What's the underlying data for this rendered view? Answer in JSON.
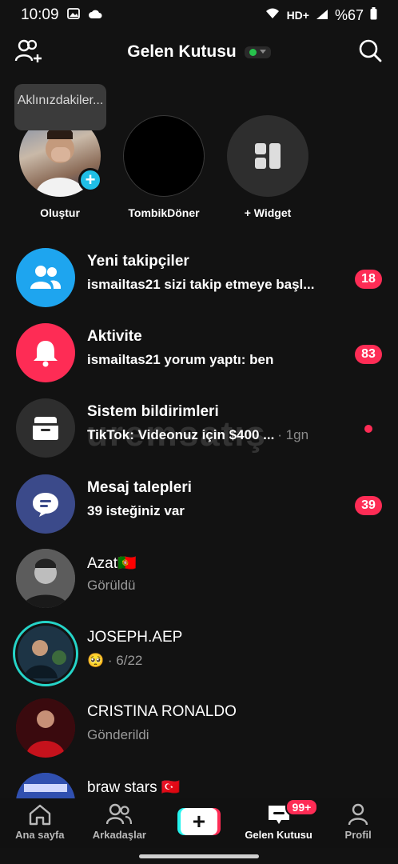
{
  "status_bar": {
    "time": "10:09",
    "battery": "%67",
    "network": "HD+"
  },
  "header": {
    "title": "Gelen Kutusu"
  },
  "tooltip": "Aklınızdakiler...",
  "stories": [
    {
      "label": "Oluştur"
    },
    {
      "label": "TombikDöner"
    },
    {
      "label": "+ Widget"
    }
  ],
  "rows": [
    {
      "title": "Yeni takipçiler",
      "subtitle": "ismailtas21 sizi takip etmeye başl...",
      "badge": "18"
    },
    {
      "title": "Aktivite",
      "subtitle": "ismailtas21 yorum yaptı: ben",
      "badge": "83"
    },
    {
      "title": "Sistem bildirimleri",
      "subtitle": "TikTok: Videonuz için $400 ...",
      "time": "· 1gn"
    },
    {
      "title": "Mesaj talepleri",
      "subtitle": "39 isteğiniz var",
      "badge": "39"
    },
    {
      "title": "Azat🇵🇹",
      "subtitle": "Görüldü"
    },
    {
      "title": "JOSEPH.AEP",
      "subtitle": "🥺 · 6/22"
    },
    {
      "title": "CRISTINA RONALDO",
      "subtitle": "Gönderildi"
    },
    {
      "title": "braw stars 🇹🇷",
      "subtitle": ""
    }
  ],
  "watermark": "uremsatış",
  "nav": {
    "home": "Ana sayfa",
    "friends": "Arkadaşlar",
    "create": "+",
    "inbox": "Gelen Kutusu",
    "inbox_badge": "99+",
    "profile": "Profil"
  },
  "colors": {
    "accent_red": "#fe2c55",
    "accent_cyan": "#25f4ee",
    "followers_blue": "#1ea5ef",
    "activity_pink": "#fe2c55",
    "system_gray": "#2e2e2e",
    "requests_indigo": "#3b4a8a"
  }
}
